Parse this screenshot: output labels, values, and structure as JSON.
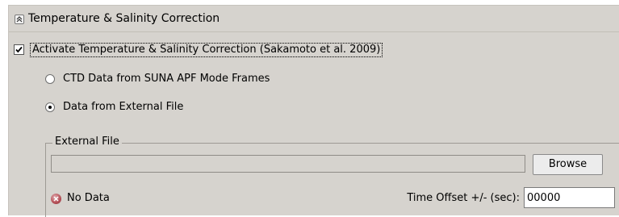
{
  "section": {
    "title": "Temperature & Salinity Correction",
    "collapse_icon": "double-chevron-up-icon"
  },
  "activate": {
    "label": "Activate Temperature & Salinity Correction (Sakamoto et al. 2009)",
    "checked": true
  },
  "source": {
    "options": [
      {
        "label": "CTD Data from SUNA APF Mode Frames",
        "selected": false
      },
      {
        "label": "Data from External File",
        "selected": true
      }
    ]
  },
  "external_file": {
    "group_title": "External File",
    "path_value": "",
    "browse_label": "Browse",
    "status_icon": "no-data-status-icon",
    "status_text": "No Data",
    "offset_label": "Time Offset +/- (sec):",
    "offset_value": "00000"
  }
}
